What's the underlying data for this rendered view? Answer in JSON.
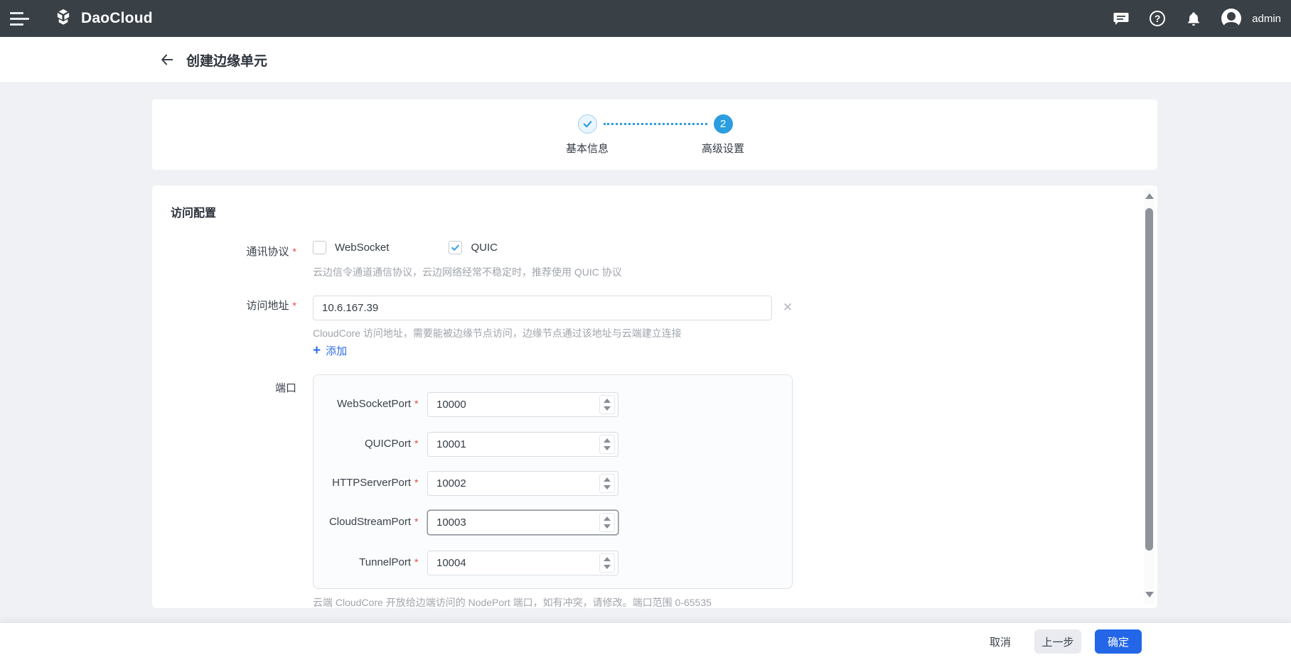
{
  "topbar": {
    "brand": "DaoCloud",
    "username": "admin"
  },
  "page": {
    "title": "创建边缘单元"
  },
  "stepper": {
    "steps": [
      {
        "label": "基本信息",
        "status": "completed"
      },
      {
        "label": "高级设置",
        "status": "current",
        "number": "2"
      }
    ]
  },
  "form": {
    "section_title": "访问配置",
    "protocol": {
      "label": "通讯协议",
      "options": [
        {
          "label": "WebSocket",
          "checked": false
        },
        {
          "label": "QUIC",
          "checked": true
        }
      ],
      "hint": "云边信令通道通信协议，云边网络经常不稳定时，推荐使用 QUIC 协议"
    },
    "address": {
      "label": "访问地址",
      "value": "10.6.167.39",
      "hint": "CloudCore 访问地址，需要能被边缘节点访问，边缘节点通过该地址与云端建立连接",
      "add_label": "添加"
    },
    "ports": {
      "label": "端口",
      "fields": [
        {
          "label": "WebSocketPort",
          "value": "10000",
          "focused": false
        },
        {
          "label": "QUICPort",
          "value": "10001",
          "focused": false
        },
        {
          "label": "HTTPServerPort",
          "value": "10002",
          "focused": false
        },
        {
          "label": "CloudStreamPort",
          "value": "10003",
          "focused": true
        },
        {
          "label": "TunnelPort",
          "value": "10004",
          "focused": false
        }
      ],
      "hint": "云端 CloudCore 开放给边端访问的 NodePort 端口，如有冲突，请修改。端口范围 0-65535"
    }
  },
  "footer": {
    "cancel_label": "取消",
    "prev_label": "上一步",
    "confirm_label": "确定"
  },
  "glyphs": {
    "required_mark": "*",
    "help": "?",
    "clear": "✕",
    "add_plus": "+"
  },
  "colors": {
    "topbar_bg": "#394046",
    "primary_blue": "#2466e8",
    "stepper_blue": "#2b9de0",
    "link_blue": "#2d6ce5",
    "hint_gray": "#a0a5ac",
    "required_red": "#e54545"
  }
}
